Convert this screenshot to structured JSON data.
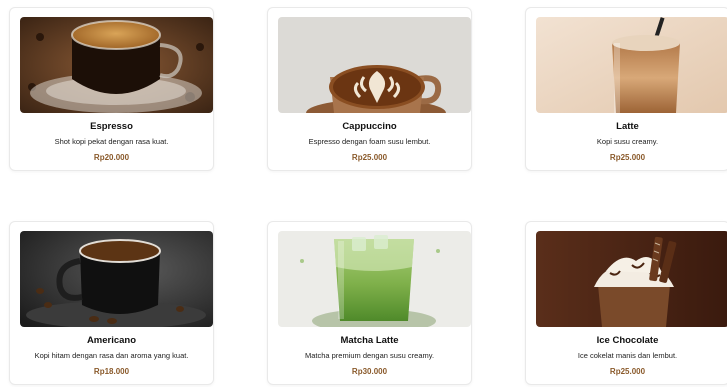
{
  "price_color": "#8a5a2b",
  "menu": [
    {
      "name": "Espresso",
      "description": "Shot kopi pekat dengan rasa kuat.",
      "price": "Rp20.000",
      "image_icon": "espresso-cup-icon"
    },
    {
      "name": "Cappuccino",
      "description": "Espresso dengan foam susu lembut.",
      "price": "Rp25.000",
      "image_icon": "cappuccino-latte-art-icon"
    },
    {
      "name": "Latte",
      "description": "Kopi susu creamy.",
      "price": "Rp25.000",
      "image_icon": "iced-latte-glass-icon"
    },
    {
      "name": "Americano",
      "description": "Kopi hitam dengan rasa dan aroma yang kuat.",
      "price": "Rp18.000",
      "image_icon": "americano-cup-icon"
    },
    {
      "name": "Matcha Latte",
      "description": "Matcha premium dengan susu creamy.",
      "price": "Rp30.000",
      "image_icon": "matcha-latte-glass-icon"
    },
    {
      "name": "Ice Chocolate",
      "description": "Ice cokelat manis dan lembut.",
      "price": "Rp25.000",
      "image_icon": "ice-chocolate-glass-icon"
    }
  ]
}
